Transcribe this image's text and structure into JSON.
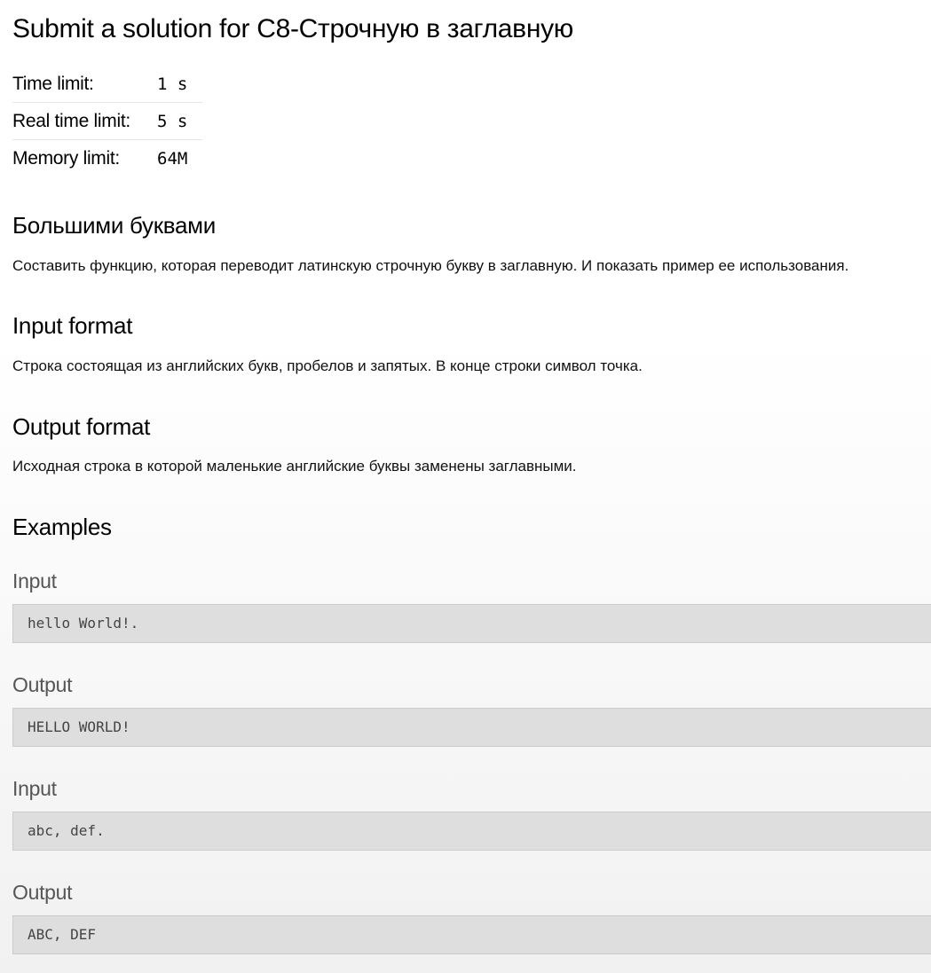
{
  "page": {
    "title": "Submit a solution for C8-Строчную в заглавную"
  },
  "limits": [
    {
      "label": "Time limit:",
      "value": "1 s"
    },
    {
      "label": "Real time limit:",
      "value": "5 s"
    },
    {
      "label": "Memory limit:",
      "value": "64M"
    }
  ],
  "statement": {
    "heading": "Большими буквами",
    "text": "Составить функцию, которая переводит латинскую строчную букву в заглавную. И показать пример ее использования."
  },
  "input_format": {
    "heading": "Input format",
    "text": "Строка состоящая из английских букв, пробелов и запятых. В конце строки символ точка."
  },
  "output_format": {
    "heading": "Output format",
    "text": "Исходная строка в которой маленькие английские буквы заменены заглавными."
  },
  "examples": {
    "heading": "Examples",
    "items": [
      {
        "label": "Input",
        "content": "hello World!."
      },
      {
        "label": "Output",
        "content": "HELLO WORLD!"
      },
      {
        "label": "Input",
        "content": "abc, def."
      },
      {
        "label": "Output",
        "content": "ABC, DEF"
      }
    ]
  }
}
